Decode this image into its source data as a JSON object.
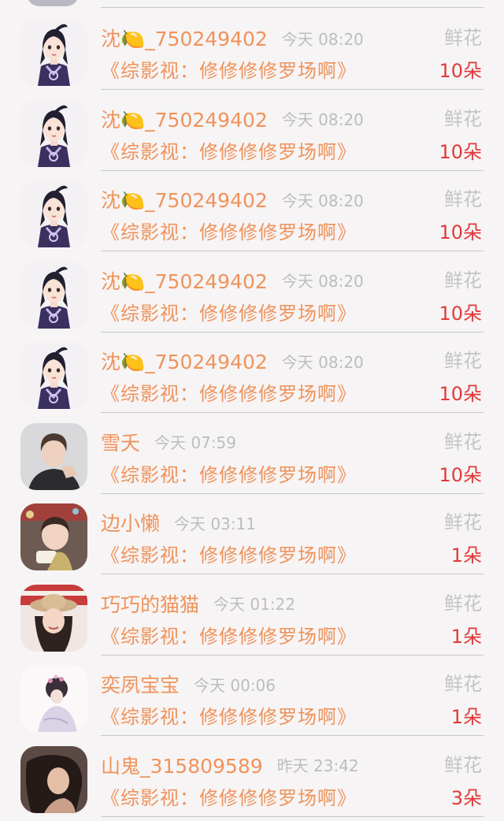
{
  "list": {
    "rows": [
      {
        "name": "沈🍋_750249402",
        "time": "今天 08:20",
        "gift": "鲜花",
        "book": "《综影视：修修修修罗场啊》",
        "count": "10朵",
        "avatar": "anime-avatar"
      },
      {
        "name": "沈🍋_750249402",
        "time": "今天 08:20",
        "gift": "鲜花",
        "book": "《综影视：修修修修罗场啊》",
        "count": "10朵",
        "avatar": "anime-avatar"
      },
      {
        "name": "沈🍋_750249402",
        "time": "今天 08:20",
        "gift": "鲜花",
        "book": "《综影视：修修修修罗场啊》",
        "count": "10朵",
        "avatar": "anime-avatar"
      },
      {
        "name": "沈🍋_750249402",
        "time": "今天 08:20",
        "gift": "鲜花",
        "book": "《综影视：修修修修罗场啊》",
        "count": "10朵",
        "avatar": "anime-avatar"
      },
      {
        "name": "沈🍋_750249402",
        "time": "今天 08:20",
        "gift": "鲜花",
        "book": "《综影视：修修修修罗场啊》",
        "count": "10朵",
        "avatar": "anime-avatar"
      },
      {
        "name": "雪夭",
        "time": "今天 07:59",
        "gift": "鲜花",
        "book": "《综影视：修修修修罗场啊》",
        "count": "10朵",
        "avatar": "man-photo-avatar"
      },
      {
        "name": "边小懒",
        "time": "今天 03:11",
        "gift": "鲜花",
        "book": "《综影视：修修修修罗场啊》",
        "count": "1朵",
        "avatar": "child-photo-avatar"
      },
      {
        "name": "巧巧的猫猫",
        "time": "今天 01:22",
        "gift": "鲜花",
        "book": "《综影视：修修修修罗场啊》",
        "count": "1朵",
        "avatar": "woman-hat-avatar"
      },
      {
        "name": "奕夙宝宝",
        "time": "今天 00:06",
        "gift": "鲜花",
        "book": "《综影视：修修修修罗场啊》",
        "count": "1朵",
        "avatar": "illustration-avatar"
      },
      {
        "name": "山鬼_315809589",
        "time": "昨天 23:42",
        "gift": "鲜花",
        "book": "《综影视：修修修修罗场啊》",
        "count": "3朵",
        "avatar": "woman-photo-avatar"
      }
    ]
  },
  "colors": {
    "accent_orange": "#ef935b",
    "count_red": "#e03a3a",
    "muted_gray": "#bdbdbd",
    "background": "#f7f4f5"
  }
}
